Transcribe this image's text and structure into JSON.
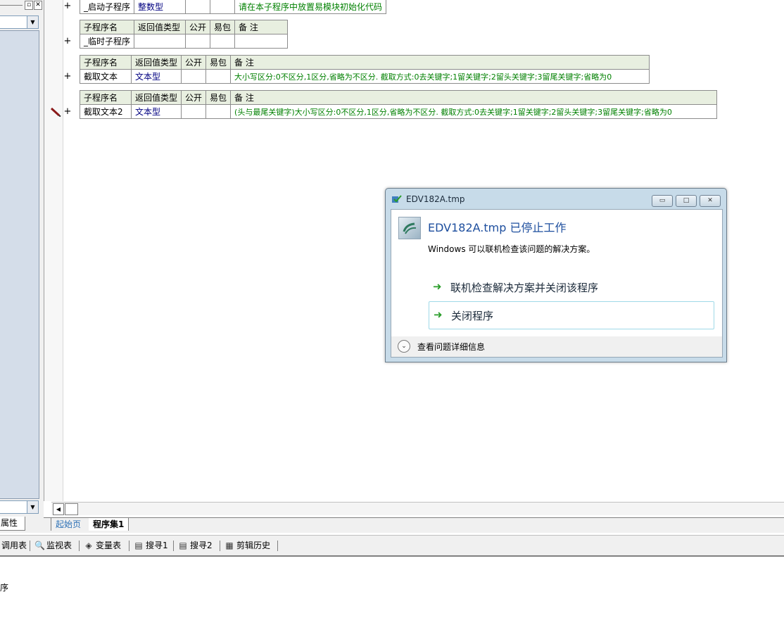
{
  "left_panel": {
    "pin_glyph": "▫",
    "close_glyph": "✕",
    "combo_arrow": "▼",
    "tab_label": "属性"
  },
  "editor": {
    "plus": "+",
    "partial_table": {
      "name": "_启动子程序",
      "type": "整数型",
      "note": "请在本子程序中放置易模块初始化代码"
    },
    "headers": {
      "name": "子程序名",
      "type": "返回值类型",
      "public": "公开",
      "pack": "易包",
      "note": "备 注"
    },
    "subroutines": [
      {
        "name": "_临时子程序",
        "type": "",
        "note": ""
      },
      {
        "name": "截取文本",
        "type": "文本型",
        "note": "大小写区分:0不区分,1区分,省略为不区分. 截取方式:0去关键字;1留关键字;2留头关键字;3留尾关键字;省略为0"
      },
      {
        "name": "截取文本2",
        "type": "文本型",
        "note": "(头与最尾关键字)大小写区分:0不区分,1区分,省略为不区分. 截取方式:0去关键字;1留关键字;2留头关键字;3留尾关键字;省略为0"
      }
    ],
    "scroll_left": "◀"
  },
  "tabs": {
    "start": "起始页",
    "program": "程序集1"
  },
  "toolbar": {
    "items": [
      {
        "label": "调用表",
        "icon": "call-table-icon"
      },
      {
        "label": "监视表",
        "icon": "magnifier-icon",
        "glyph": "🔍"
      },
      {
        "label": "变量表",
        "icon": "variable-icon",
        "glyph": "◈"
      },
      {
        "label": "搜寻1",
        "icon": "search-list-icon",
        "glyph": "▤"
      },
      {
        "label": "搜寻2",
        "icon": "search-list-icon",
        "glyph": "▤"
      },
      {
        "label": "剪辑历史",
        "icon": "clipboard-history-icon",
        "glyph": "▦"
      }
    ]
  },
  "output": {
    "line": "序"
  },
  "dialog": {
    "title": "EDV182A.tmp",
    "heading": "EDV182A.tmp 已停止工作",
    "subtext": "Windows 可以联机检查该问题的解决方案。",
    "option_check": "联机检查解决方案并关闭该程序",
    "option_close": "关闭程序",
    "details": "查看问题详细信息",
    "arrow_glyph": "➜",
    "min_glyph": "▭",
    "max_glyph": "□",
    "close_glyph": "✕",
    "expand_glyph": "⌄",
    "accent": "#1d4e9e",
    "arrow_color": "#2a9d2a"
  }
}
